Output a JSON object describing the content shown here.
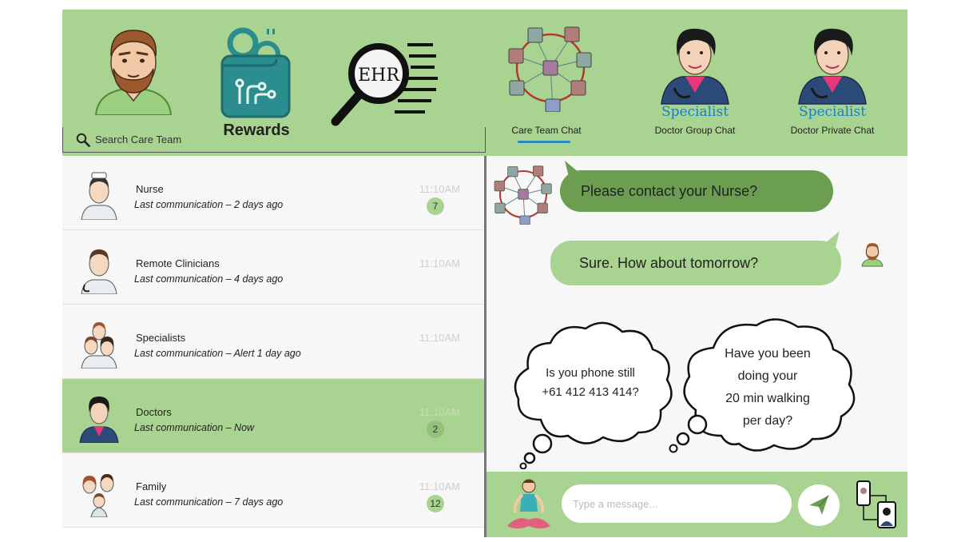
{
  "header": {
    "search": {
      "placeholder": "Search Care Team"
    },
    "rewards_label": "Rewards",
    "ehr_label": "EHR",
    "tabs": [
      {
        "sub": "",
        "label": "Care Team Chat",
        "active": true
      },
      {
        "sub": "Specialist",
        "label": "Doctor Group Chat",
        "active": false
      },
      {
        "sub": "Specialist",
        "label": "Doctor Private Chat",
        "active": false
      }
    ]
  },
  "contacts": [
    {
      "name": "Nurse",
      "last": "Last communication – 2 days ago",
      "time": "11:10AM",
      "badge": "7",
      "active": false
    },
    {
      "name": "Remote Clinicians",
      "last": "Last communication – 4 days ago",
      "time": "11:10AM",
      "badge": "",
      "active": false
    },
    {
      "name": "Specialists",
      "last": "Last communication – Alert 1 day ago",
      "time": "11:10AM",
      "badge": "",
      "active": false
    },
    {
      "name": "Doctors",
      "last": "Last communication – Now",
      "time": "11:10AM",
      "badge": "2",
      "active": true
    },
    {
      "name": "Family",
      "last": "Last communication – 7 days ago",
      "time": "11:10AM",
      "badge": "12",
      "active": false
    }
  ],
  "chat": {
    "messages": [
      {
        "from": "care-team",
        "text": "Please contact your Nurse?"
      },
      {
        "from": "patient",
        "text": "Sure. How about tomorrow?"
      }
    ],
    "thoughts": [
      {
        "lines": [
          "Is you phone still",
          "+61 412 413 414?"
        ]
      },
      {
        "lines": [
          "Have you been",
          "doing your",
          "20 min walking",
          "per day?"
        ]
      }
    ]
  },
  "input": {
    "placeholder": "Type a message..."
  },
  "colors": {
    "green": "#a9d391",
    "dark_green": "#6c9e52",
    "teal": "#2a8c8c",
    "accent_blue": "#1a7fc0"
  }
}
